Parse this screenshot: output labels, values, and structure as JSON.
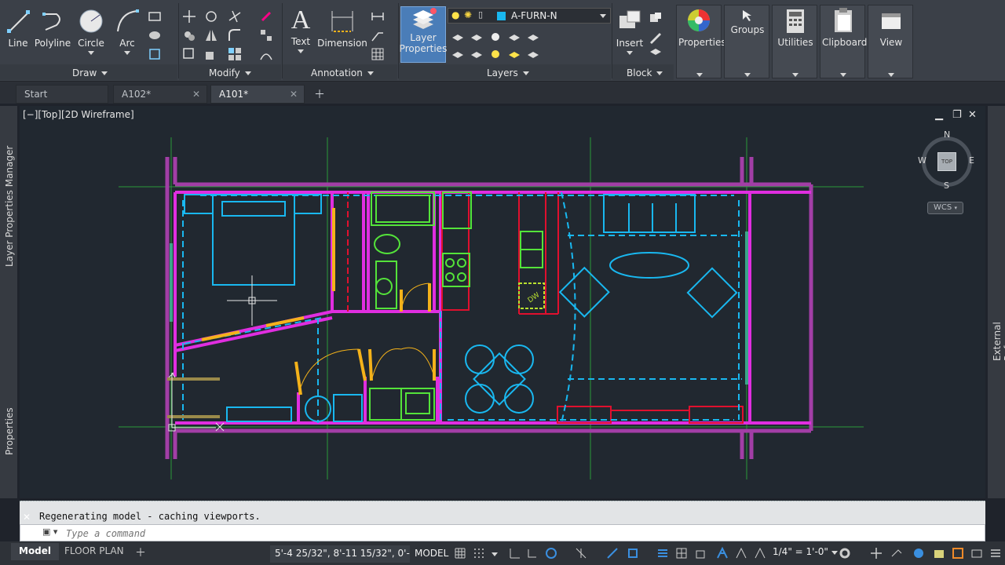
{
  "ribbon": {
    "draw": {
      "line": "Line",
      "polyline": "Polyline",
      "circle": "Circle",
      "arc": "Arc",
      "panel": "Draw"
    },
    "modify": {
      "panel": "Modify"
    },
    "annotation": {
      "text": "Text",
      "dimension": "Dimension",
      "panel": "Annotation"
    },
    "layers": {
      "layer_properties_line1": "Layer",
      "layer_properties_line2": "Properties",
      "current_layer": "A-FURN-N",
      "current_layer_color": "#19b8f0",
      "panel": "Layers"
    },
    "block": {
      "insert": "Insert",
      "panel": "Block"
    },
    "properties": "Properties",
    "groups": "Groups",
    "utilities": "Utilities",
    "clipboard": "Clipboard",
    "view": "View"
  },
  "tabs": [
    {
      "label": "Start"
    },
    {
      "label": "A102*"
    },
    {
      "label": "A101*"
    }
  ],
  "palettes": {
    "left_top": "Layer Properties Manager",
    "left_bottom": "Properties",
    "right": "External References"
  },
  "viewport": {
    "label": "[−][Top][2D Wireframe]",
    "viewcube": {
      "north": "N",
      "south": "S",
      "east": "E",
      "west": "W",
      "face": "TOP"
    },
    "wcs": "WCS",
    "dishwasher_label": "DW"
  },
  "colors": {
    "wall": "#c12ec1",
    "partition": "#f025e8",
    "furniture": "#19b8f0",
    "fixture": "#54e33a",
    "door": "#f4b21a",
    "casework": "#e0102e",
    "grid": "#2a9a3a",
    "window": "#3aa58a"
  },
  "command": {
    "history": "Regenerating model - caching viewports.",
    "placeholder": "Type a command"
  },
  "status": {
    "layout_tabs": [
      {
        "label": "Model"
      },
      {
        "label": "FLOOR PLAN"
      }
    ],
    "coordinates": "5'-4 25/32\", 8'-11 15/32\", 0'-0\"",
    "space": "MODEL",
    "scale": "1/4\" = 1'-0\""
  }
}
